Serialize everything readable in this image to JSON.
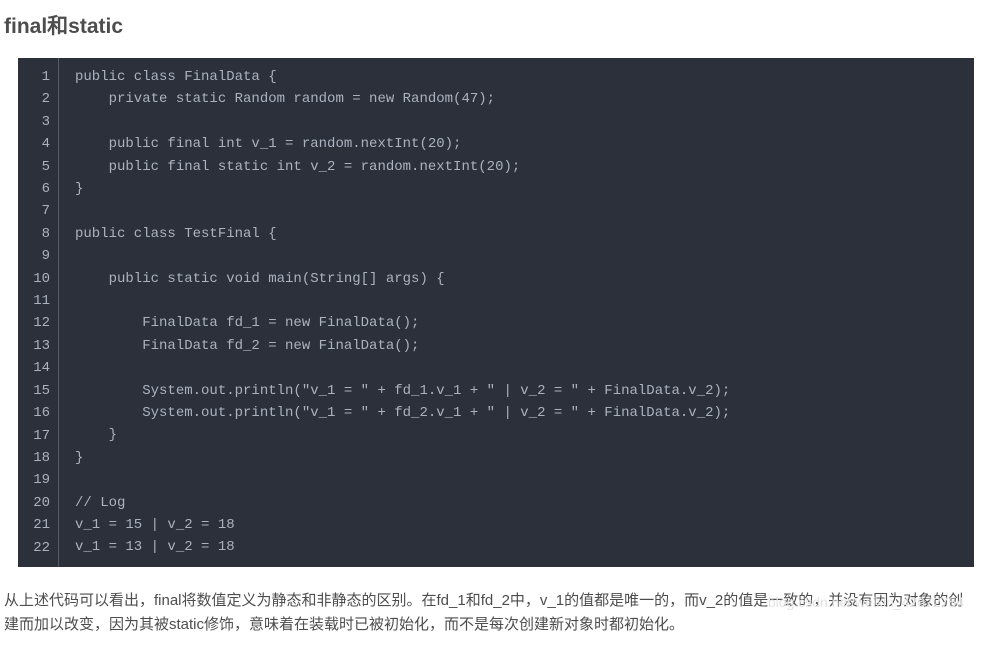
{
  "heading": "final和static",
  "code": {
    "lines": [
      "public class FinalData {",
      "    private static Random random = new Random(47);",
      "",
      "    public final int v_1 = random.nextInt(20);",
      "    public final static int v_2 = random.nextInt(20);",
      "}",
      "",
      "public class TestFinal {",
      "",
      "    public static void main(String[] args) {",
      "",
      "        FinalData fd_1 = new FinalData();",
      "        FinalData fd_2 = new FinalData();",
      "",
      "        System.out.println(\"v_1 = \" + fd_1.v_1 + \" | v_2 = \" + FinalData.v_2);",
      "        System.out.println(\"v_1 = \" + fd_2.v_1 + \" | v_2 = \" + FinalData.v_2);",
      "    }",
      "}",
      "",
      "// Log",
      "v_1 = 15 | v_2 = 18",
      "v_1 = 13 | v_2 = 18"
    ]
  },
  "paragraph": "从上述代码可以看出，final将数值定义为静态和非静态的区别。在fd_1和fd_2中，v_1的值都是唯一的，而v_2的值是一致的，并没有因为对象的创建而加以改变，因为其被static修饰，意味着在装载时已被初始化，而不是每次创建新对象时都初始化。",
  "watermark": "blog.csdn.net/weixin_42072754"
}
